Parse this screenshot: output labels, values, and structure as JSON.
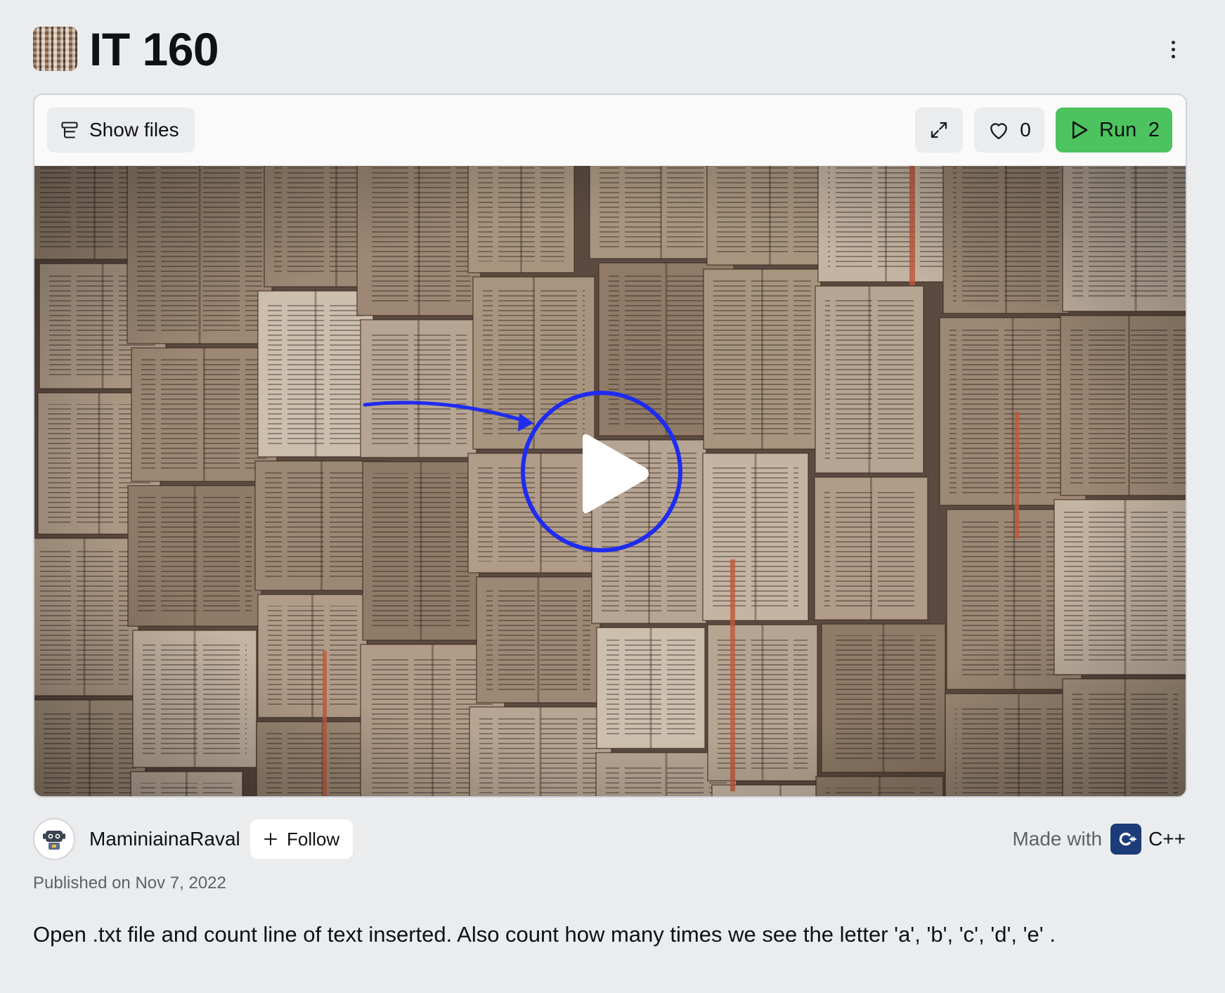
{
  "repl": {
    "title": "IT 160",
    "avatar_icon": "repl-cover-thumbnail",
    "menu_icon": "kebab-menu-icon"
  },
  "toolbar": {
    "show_files_label": "Show files",
    "show_files_icon": "files-icon",
    "expand_icon": "expand-icon",
    "like_icon": "heart-icon",
    "like_count": "0",
    "run_label": "Run",
    "run_count": "2",
    "run_icon": "play-icon",
    "run_color": "#4cc35e"
  },
  "cover": {
    "description": "cover image",
    "overlay_play_icon": "play-icon",
    "annotation_color": "#1f2cf0"
  },
  "author": {
    "name": "MaminiainaRaval",
    "follow_label": "Follow",
    "follow_icon": "plus-icon",
    "avatar_icon": "robot-avatar-icon"
  },
  "made_with": {
    "label": "Made with",
    "language": "C++",
    "language_icon": "cpp-logo-icon",
    "language_color": "#1b3c78"
  },
  "published": "Published on Nov 7, 2022",
  "description": "Open .txt file and count line of text inserted. Also count how many times we see the letter 'a', 'b', 'c', 'd', 'e' ."
}
